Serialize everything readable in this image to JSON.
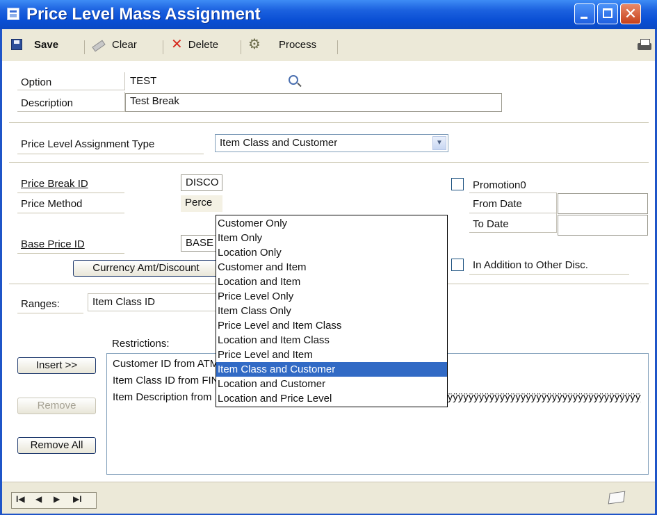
{
  "window": {
    "title": "Price Level Mass Assignment"
  },
  "toolbar": {
    "save_label": "Save",
    "clear_label": "Clear",
    "delete_label": "Delete",
    "process_label": "Process"
  },
  "form": {
    "option_label": "Option",
    "option_value": "TEST",
    "description_label": "Description",
    "description_value": "Test Break",
    "assignment_type_label": "Price Level Assignment Type",
    "assignment_type_value": "Item Class and Customer",
    "price_break_label": "Price Break ID",
    "price_break_value": "DISCO",
    "price_method_label": "Price Method",
    "price_method_value": "Perce",
    "base_price_label": "Base Price ID",
    "base_price_value": "BASE",
    "currency_button": "Currency Amt/Discount",
    "promotion_label": "Promotion0",
    "from_date_label": "From Date",
    "to_date_label": "To Date",
    "in_addition_label": "In Addition to Other Disc.",
    "ranges_label": "Ranges:",
    "ranges_value": "Item Class ID",
    "restrictions_label": "Restrictions:",
    "insert_button": "Insert >>",
    "remove_button": "Remove",
    "remove_all_button": "Remove All",
    "restrictions": [
      "Customer ID from ATMORERE0001 to ATMORERE0001",
      "Item Class ID from FINGOODS to FINGOODS",
      "Item Description from First Item Description to ÿÿÿÿÿÿÿÿÿÿÿÿÿÿÿÿÿÿÿÿÿÿÿÿÿÿÿÿÿÿÿÿÿÿÿÿÿÿÿÿÿÿÿÿÿÿÿÿÿÿÿÿÿÿÿÿÿÿÿÿÿÿÿÿÿÿÿÿÿÿÿÿ"
    ]
  },
  "dropdown": {
    "selected": "Item Class and Customer",
    "options": [
      "Customer Only",
      "Item Only",
      "Location Only",
      "Customer and Item",
      "Location and Item",
      "Price Level Only",
      "Item Class Only",
      "Price Level and Item Class",
      "Location and Item Class",
      "Price Level and Item",
      "Item Class and Customer",
      "Location and Customer",
      "Location and Price Level"
    ]
  },
  "statusbar": {
    "nav": [
      "I◀",
      "◀",
      "▶",
      "▶I"
    ]
  }
}
